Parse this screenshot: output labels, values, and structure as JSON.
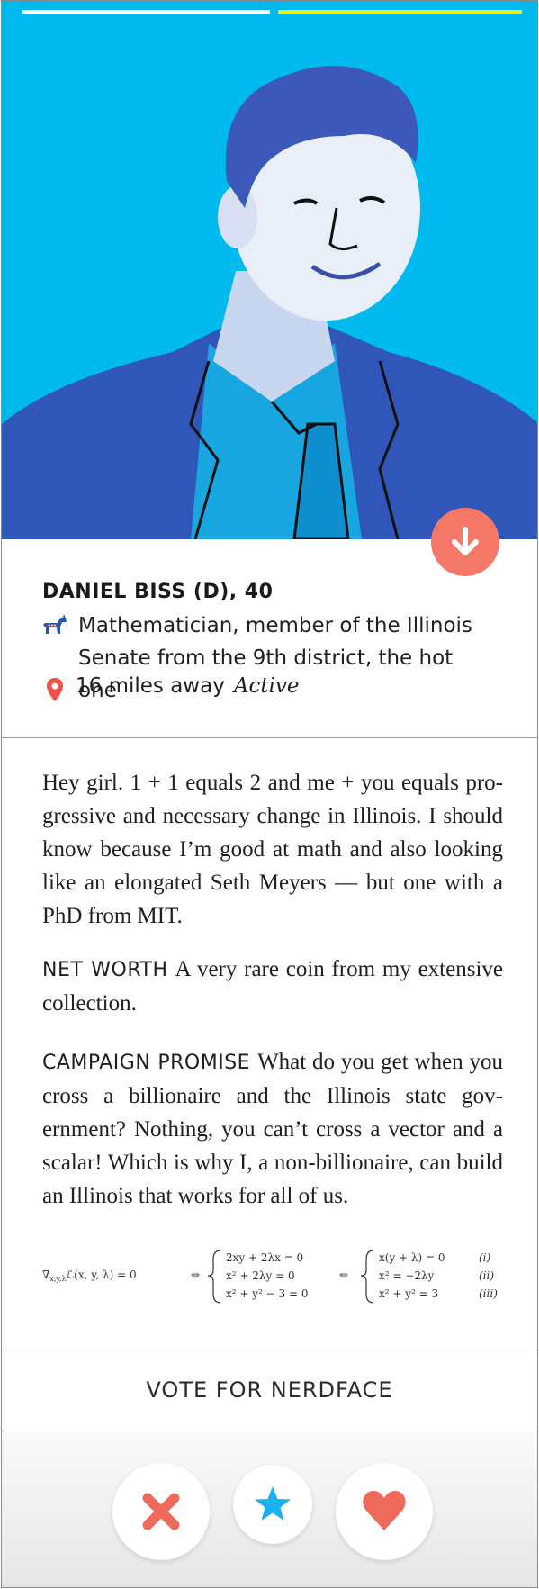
{
  "profile": {
    "name": "DANIEL BISS (D), 40",
    "occupation": "Mathematician, member of the Illinois Senate from the 9th district, the hot one",
    "distance": "16 miles away",
    "status": "Active",
    "party_icon": "donkey-icon",
    "location_icon": "map-pin-icon"
  },
  "bio": {
    "intro": "Hey girl. 1 + 1 equals 2 and me + you equals pro­gressive and necessary change in Illinois. I should know because I’m good at math and also looking like an elongated Seth Meyers — but one with a PhD from MIT.",
    "net_worth_label": "NET WORTH",
    "net_worth": "A very rare coin from my extensive collection.",
    "promise_label": "CAMPAIGN PROMISE",
    "promise": "What do you get when you cross a billionaire and the Illinois state gov­ernment? Nothing, you can’t cross a vector and a scalar! Which is why I, a non-billionaire, can build an Illinois that works for all of us."
  },
  "math": {
    "lhs_sub": "x,y,λ",
    "lhs": "ℒ(x, y, λ) = 0",
    "iff": "⇔",
    "sys1": [
      "2xy + 2λx = 0",
      "x² + 2λy = 0",
      "x² + y² − 3 = 0"
    ],
    "sys2": [
      "x(y + λ) = 0",
      "x² = −2λy",
      "x² + y² = 3"
    ],
    "tags": [
      "(i)",
      "(ii)",
      "(iii)"
    ]
  },
  "vote_label": "VOTE FOR NERDFACE",
  "colors": {
    "hero_bg": "#00b9ee",
    "progress_active": "#ffffff",
    "progress_inactive": "#e8f01a",
    "accent_red": "#f57868",
    "star_blue": "#1ab3ef",
    "suit": "#2f56b8"
  },
  "actions": {
    "dislike_icon": "x-icon",
    "superlike_icon": "star-icon",
    "like_icon": "heart-icon",
    "expand_icon": "arrow-down-icon"
  }
}
